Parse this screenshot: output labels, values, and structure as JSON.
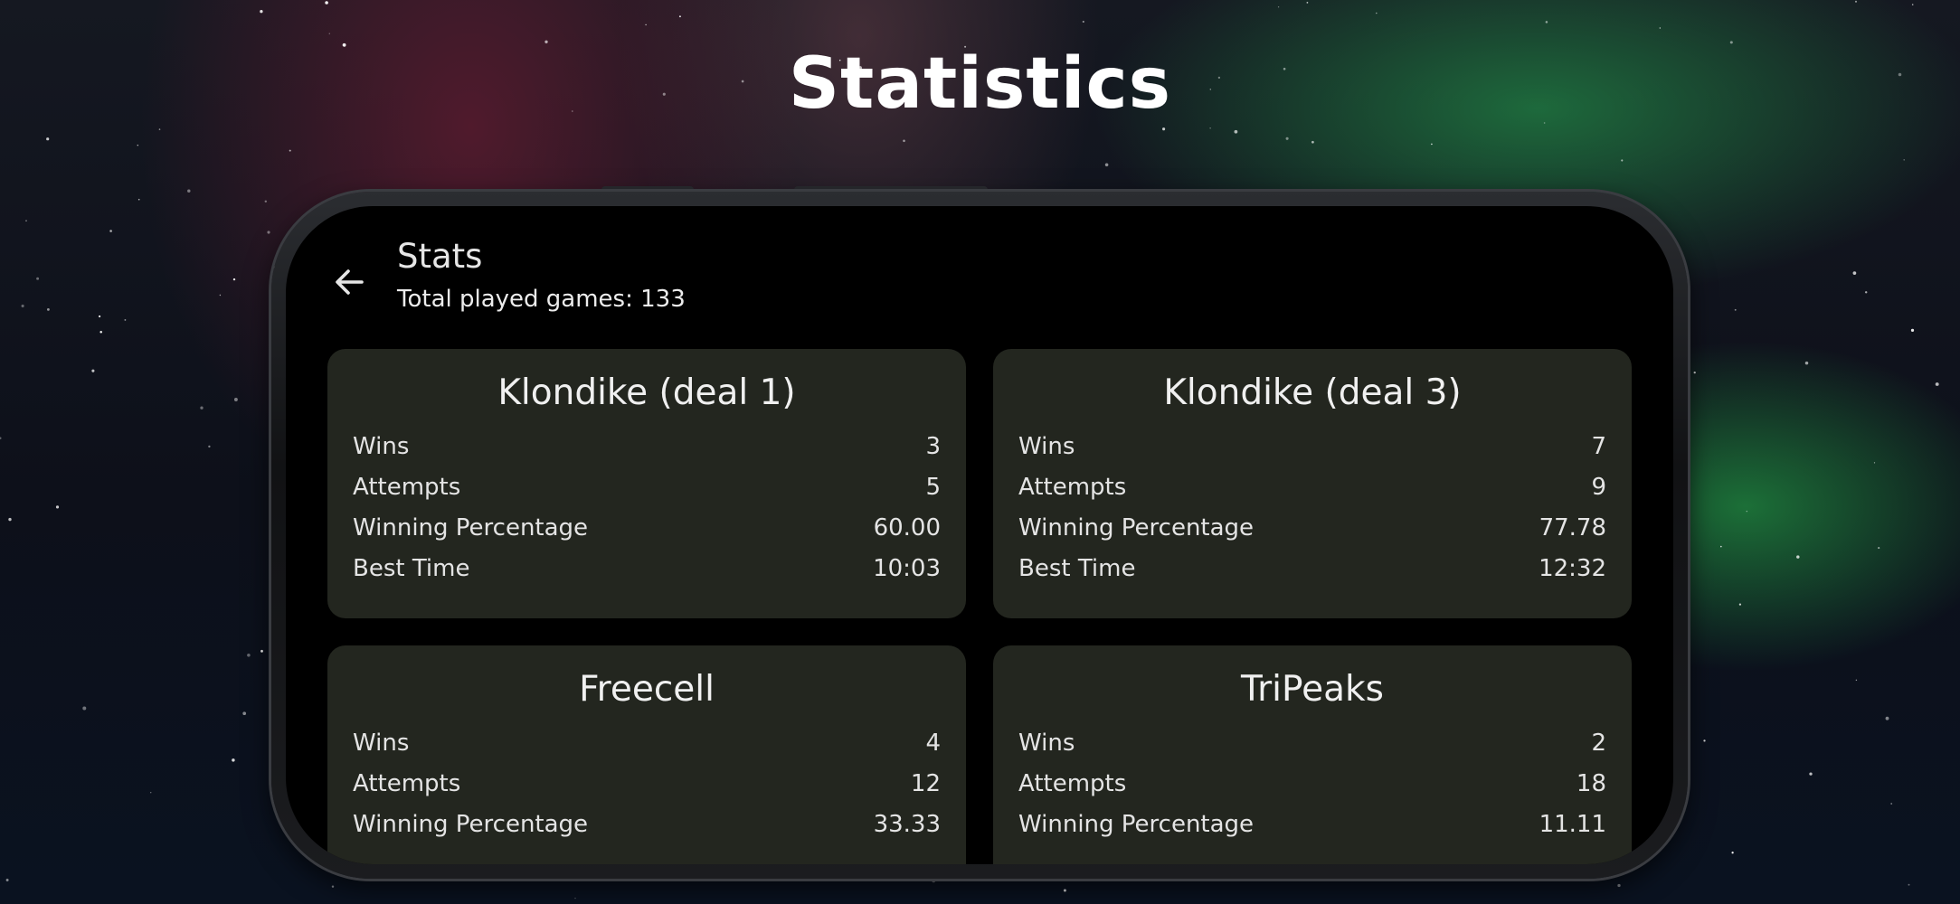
{
  "banner": {
    "title": "Statistics"
  },
  "app": {
    "title": "Stats",
    "subtitle": "Total played games: 133"
  },
  "icons": {
    "back": "arrow-left-icon"
  },
  "colors": {
    "card_background": "#23261f",
    "screen_background": "#000000",
    "text": "#e4e4e4"
  },
  "cards": [
    {
      "title": "Klondike (deal 1)",
      "rows": [
        {
          "label": "Wins",
          "value": "3"
        },
        {
          "label": "Attempts",
          "value": "5"
        },
        {
          "label": "Winning Percentage",
          "value": "60.00"
        },
        {
          "label": "Best Time",
          "value": "10:03"
        }
      ]
    },
    {
      "title": "Klondike (deal 3)",
      "rows": [
        {
          "label": "Wins",
          "value": "7"
        },
        {
          "label": "Attempts",
          "value": "9"
        },
        {
          "label": "Winning Percentage",
          "value": "77.78"
        },
        {
          "label": "Best Time",
          "value": "12:32"
        }
      ]
    },
    {
      "title": "Freecell",
      "rows": [
        {
          "label": "Wins",
          "value": "4"
        },
        {
          "label": "Attempts",
          "value": "12"
        },
        {
          "label": "Winning Percentage",
          "value": "33.33"
        }
      ]
    },
    {
      "title": "TriPeaks",
      "rows": [
        {
          "label": "Wins",
          "value": "2"
        },
        {
          "label": "Attempts",
          "value": "18"
        },
        {
          "label": "Winning Percentage",
          "value": "11.11"
        }
      ]
    }
  ]
}
